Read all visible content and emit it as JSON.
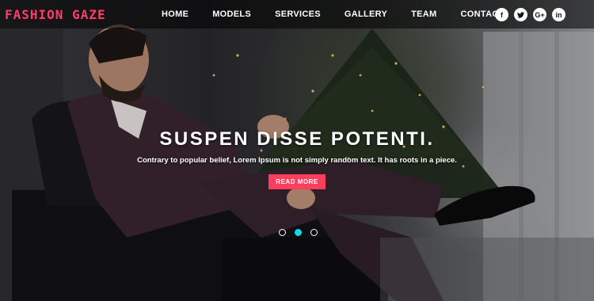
{
  "logo": {
    "text": "FASHION GAZE"
  },
  "nav": {
    "items": [
      {
        "label": "HOME"
      },
      {
        "label": "MODELS"
      },
      {
        "label": "SERVICES"
      },
      {
        "label": "GALLERY"
      },
      {
        "label": "TEAM"
      },
      {
        "label": "CONTACT"
      }
    ]
  },
  "socials": [
    {
      "glyph": "f",
      "icon": "facebook-icon"
    },
    {
      "glyph": "t",
      "icon": "twitter-icon"
    },
    {
      "glyph": "G+",
      "icon": "google-plus-icon"
    },
    {
      "glyph": "in",
      "icon": "linkedin-icon"
    }
  ],
  "slide": {
    "headline": "SUSPEN DISSE POTENTI.",
    "subtext": "Contrary to popular belief, Lorem Ipsum is not simply random text. It has roots in a piece.",
    "cta_label": "READ MORE"
  },
  "slider": {
    "count": 3,
    "active_index": 1
  },
  "colors": {
    "accent": "#ff3d5d",
    "logo": "#ff3d6a",
    "active_dot": "#19d6e6"
  }
}
